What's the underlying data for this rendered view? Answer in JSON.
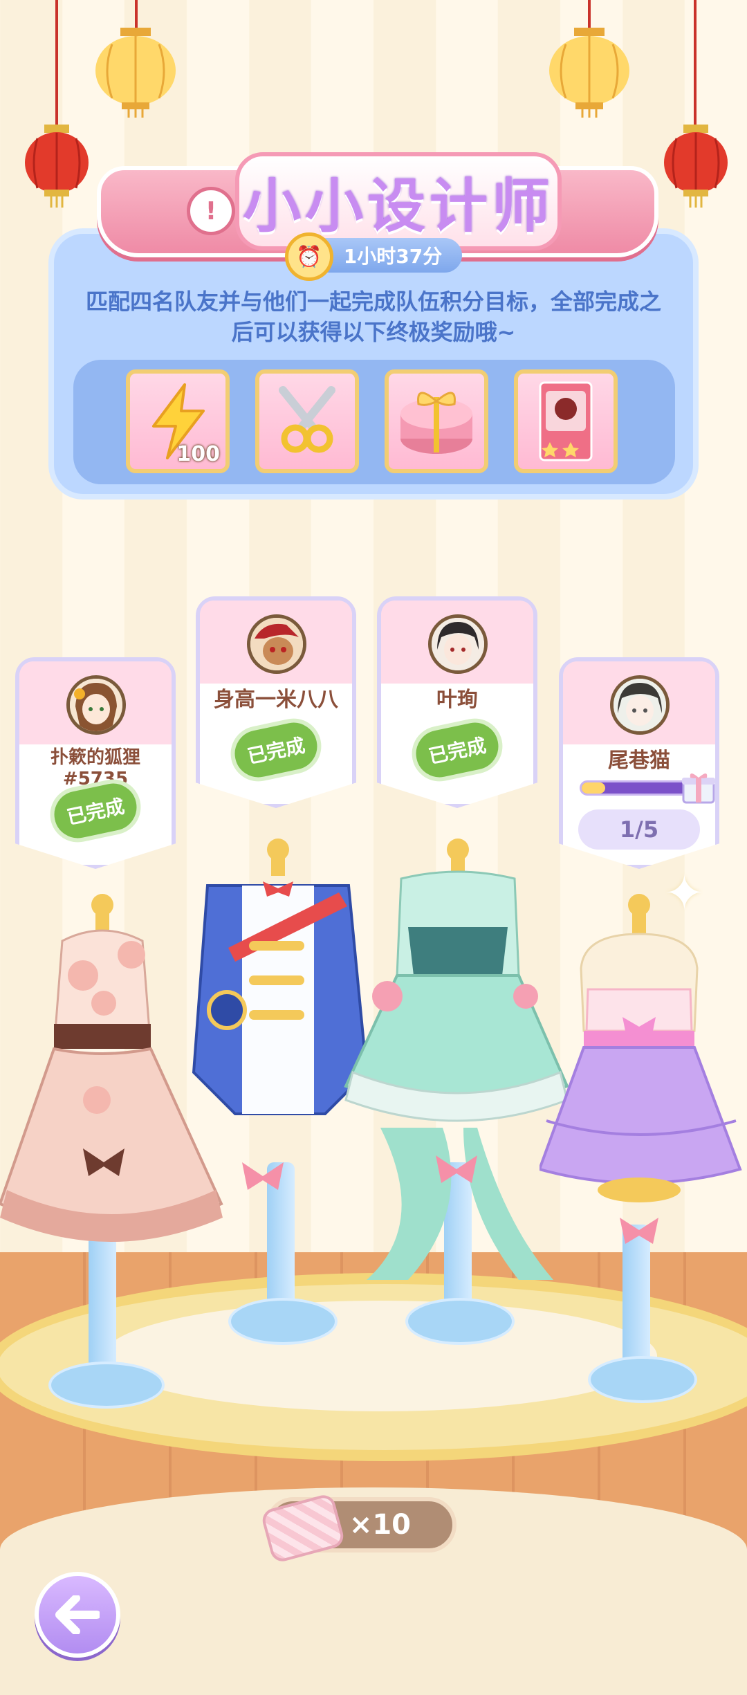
{
  "event": {
    "title": "小小设计师",
    "timer": "1小时37分",
    "description": "匹配四名队友并与他们一起完成队伍积分目标，全部完成之后可以获得以下终极奖励哦~"
  },
  "rewards": [
    {
      "icon": "lightning-icon",
      "count": "100"
    },
    {
      "icon": "scissors-icon",
      "count": ""
    },
    {
      "icon": "gift-cake-icon",
      "count": ""
    },
    {
      "icon": "card-pack-icon",
      "count": ""
    }
  ],
  "members": [
    {
      "name": "扑簌的狐狸#5735",
      "status": "已完成"
    },
    {
      "name": "身高一米八八",
      "status": "已完成"
    },
    {
      "name": "叶珣",
      "status": "已完成"
    },
    {
      "name": "尾巷猫",
      "progress_text": "1/5",
      "progress_fraction": 0.2
    }
  ],
  "footer": {
    "cloth_count": "×10",
    "back_icon": "back-arrow-icon"
  },
  "colors": {
    "panel": "#bcd7ff",
    "banner": "#ef8ba6",
    "done": "#7cbf4b",
    "progress": "#7b51c9"
  }
}
